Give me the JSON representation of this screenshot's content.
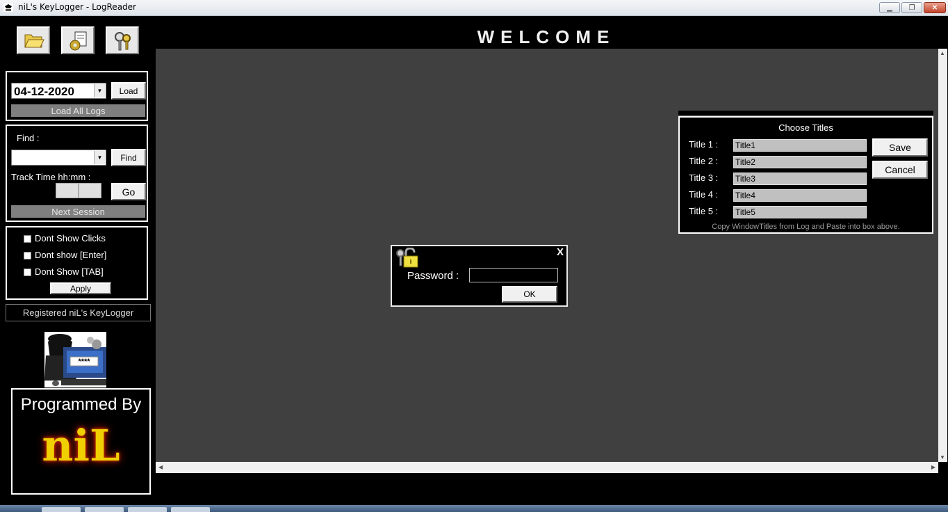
{
  "window": {
    "title": "niL's KeyLogger  -  LogReader"
  },
  "toolbar": {
    "icons": [
      "open-folder-icon",
      "settings-document-icon",
      "keys-icon"
    ]
  },
  "welcome": "WELCOME",
  "load_panel": {
    "date_value": "04-12-2020",
    "load_label": "Load",
    "load_all_label": "Load All Logs"
  },
  "find_panel": {
    "find_label": "Find :",
    "find_value": "",
    "find_button": "Find",
    "track_time_label": "Track Time hh:mm :",
    "go_button": "Go",
    "next_session_label": "Next Session"
  },
  "options_panel": {
    "options": [
      {
        "label": "Dont Show Clicks",
        "checked": false
      },
      {
        "label": "Dont show [Enter]",
        "checked": false
      },
      {
        "label": "Dont Show [TAB]",
        "checked": false
      }
    ],
    "apply_label": "Apply"
  },
  "registered_label": "Registered niL's KeyLogger",
  "password_image_text": "****",
  "programmed": {
    "line1": "Programmed By",
    "line2": "niL"
  },
  "choose_titles": {
    "heading": "Choose Titles",
    "rows": [
      {
        "label": "Title 1 :",
        "value": "Title1"
      },
      {
        "label": "Title 2 :",
        "value": "Title2"
      },
      {
        "label": "Title 3 :",
        "value": "Title3"
      },
      {
        "label": "Title 4 :",
        "value": "Title4"
      },
      {
        "label": "Title 5 :",
        "value": "Title5"
      }
    ],
    "save_label": "Save",
    "cancel_label": "Cancel",
    "hint": "Copy WindowTitles from Log and Paste into box above."
  },
  "password_dialog": {
    "close_label": "X",
    "password_label": "Password  :",
    "password_value": "",
    "ok_label": "OK"
  },
  "colors": {
    "background": "#000000",
    "main_area": "#404040",
    "logo_yellow": "#f0d000",
    "accent_close": "#c4442b"
  }
}
